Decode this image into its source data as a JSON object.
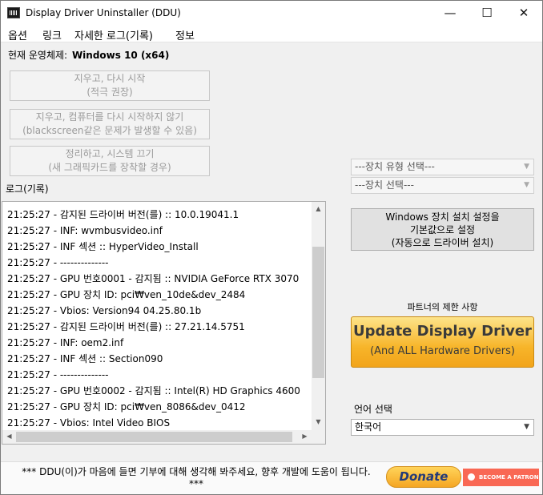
{
  "window": {
    "title": "Display Driver Uninstaller (DDU)",
    "minimize_glyph": "—",
    "maximize_glyph": "☐",
    "close_glyph": "✕"
  },
  "menu": [
    "옵션",
    "링크",
    "자세한 로그(기록)",
    "정보"
  ],
  "os": {
    "label": "현재 운영체제:",
    "value": "Windows 10 (x64)"
  },
  "actions": [
    {
      "line1": "지우고, 다시 시작",
      "line2": "(적극 권장)"
    },
    {
      "line1": "지우고, 컴퓨터를 다시 시작하지 않기",
      "line2": "(blackscreen같은 문제가 발생할 수 있음)"
    },
    {
      "line1": "정리하고, 시스템 끄기",
      "line2": "(새 그래픽카드를 장착할 경우)"
    }
  ],
  "log": {
    "label": "로그(기록)",
    "lines": [
      "21:25:27 - 감지된 드라이버 버전(를) :: 10.0.19041.1",
      "21:25:27 - INF: wvmbusvideo.inf",
      "21:25:27 - INF 섹션 :: HyperVideo_Install",
      "21:25:27 - --------------",
      "21:25:27 - GPU 번호0001 - 감지됨 :: NVIDIA GeForce RTX 3070",
      "21:25:27 - GPU 장치 ID: pci₩ven_10de&dev_2484",
      "21:25:27 - Vbios: Version94 04.25.80.1b",
      "21:25:27 - 감지된 드라이버 버전(를) :: 27.21.14.5751",
      "21:25:27 - INF: oem2.inf",
      "21:25:27 - INF 섹션 :: Section090",
      "21:25:27 - --------------",
      "21:25:27 - GPU 번호0002 - 감지됨 :: Intel(R) HD Graphics 4600",
      "21:25:27 - GPU 장치 ID: pci₩ven_8086&dev_0412",
      "21:25:27 - Vbios: Intel Video BIOS"
    ]
  },
  "device_type_select": {
    "value": "---장치 유형 선택---"
  },
  "device_select": {
    "value": "---장치 선택---"
  },
  "reset_button": {
    "line1": "Windows 장치 설치 설정을",
    "line2": "기본값으로 설정",
    "line3": "(자동으로 드라이버 설치)"
  },
  "partner": {
    "label": "파트너의 제한 사항",
    "title": "Update Display Driver",
    "subtitle": "(And ALL Hardware Drivers)"
  },
  "language": {
    "label": "언어 선택",
    "value": "한국어"
  },
  "footer": {
    "line1": "*** DDU(이)가 마음에 들면 기부에 대해 생각해 봐주세요, 향후 개발에 도움이 됩니다.",
    "line2": "***",
    "donate_label": "Donate",
    "patron_label": "BECOME A PATRON"
  },
  "colors": {
    "update_button": "#f7b52a",
    "donate_text": "#233a78",
    "patreon": "#f96854"
  }
}
